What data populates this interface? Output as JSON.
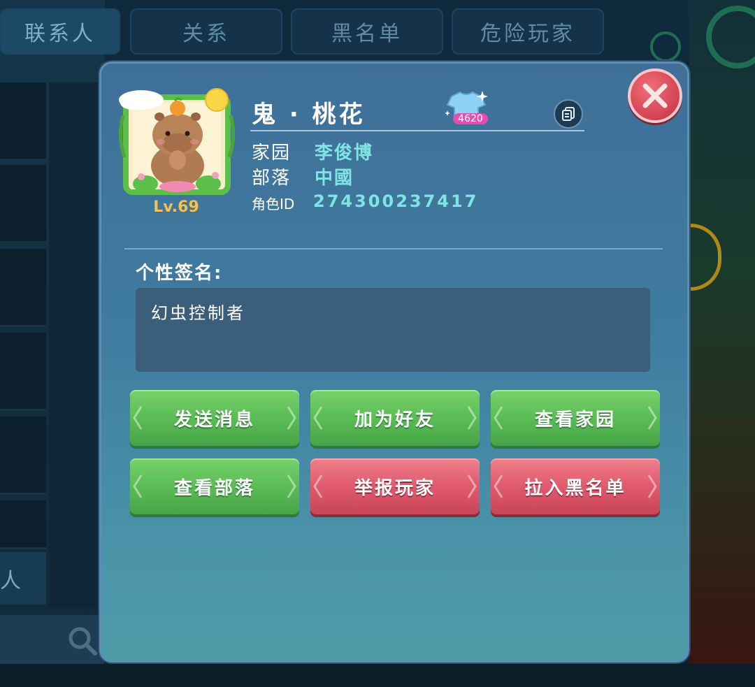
{
  "background": {
    "tabs": [
      "联系人",
      "关系",
      "黑名单",
      "危险玩家"
    ],
    "side_label": "人"
  },
  "profile": {
    "name": "鬼 · 桃花",
    "level": "Lv.69",
    "outfit_count": "4620",
    "home_label": "家园",
    "home_value": "李俊博",
    "tribe_label": "部落",
    "tribe_value": "中國",
    "role_id_label": "角色ID",
    "role_id_value": "274300237417"
  },
  "signature": {
    "title": "个性签名:",
    "text": "幻虫控制者"
  },
  "actions": {
    "send_message": "发送消息",
    "add_friend": "加为好友",
    "view_home": "查看家园",
    "view_tribe": "查看部落",
    "report_player": "举报玩家",
    "blacklist": "拉入黑名单"
  },
  "icons": {
    "close": "close-icon",
    "copy": "copy-icon",
    "outfit": "tshirt-icon",
    "search": "search-icon",
    "avatar": "capybara-avatar"
  },
  "colors": {
    "dialog_top": "#3f6f98",
    "dialog_bottom": "#4e9ca8",
    "accent_value": "#7fe5e4",
    "green_button": "#5bbd55",
    "red_button": "#df5a6d",
    "level_gold": "#f1c15a"
  }
}
